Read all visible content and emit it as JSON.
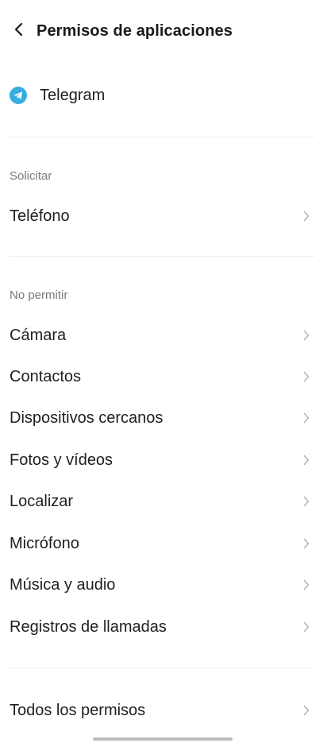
{
  "header": {
    "title": "Permisos de aplicaciones",
    "back_icon": "chevron-left-icon"
  },
  "app": {
    "name": "Telegram",
    "icon": "telegram-icon",
    "icon_color": "#37aee2"
  },
  "sections": [
    {
      "label": "Solicitar",
      "items": [
        {
          "label": "Teléfono"
        }
      ]
    },
    {
      "label": "No permitir",
      "items": [
        {
          "label": "Cámara"
        },
        {
          "label": "Contactos"
        },
        {
          "label": "Dispositivos cercanos"
        },
        {
          "label": "Fotos y vídeos"
        },
        {
          "label": "Localizar"
        },
        {
          "label": "Micrófono"
        },
        {
          "label": "Música y audio"
        },
        {
          "label": "Registros de llamadas"
        }
      ]
    }
  ],
  "footer": {
    "all_permissions_label": "Todos los permisos"
  }
}
